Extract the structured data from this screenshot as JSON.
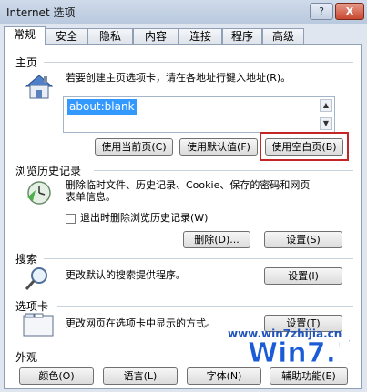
{
  "window": {
    "title": "Internet 选项",
    "help_label": "?",
    "close_label": "X"
  },
  "tabs": [
    {
      "label": "常规"
    },
    {
      "label": "安全"
    },
    {
      "label": "隐私"
    },
    {
      "label": "内容"
    },
    {
      "label": "连接"
    },
    {
      "label": "程序"
    },
    {
      "label": "高级"
    }
  ],
  "home": {
    "title": "主页",
    "desc": "若要创建主页选项卡，请在各地址行键入地址(R)。",
    "address": "about:blank",
    "btn_current": "使用当前页(C)",
    "btn_default": "使用默认值(F)",
    "btn_blank": "使用空白页(B)"
  },
  "history": {
    "title": "浏览历史记录",
    "desc_line1": "删除临时文件、历史记录、Cookie、保存的密码和网页",
    "desc_line2": "表单信息。",
    "checkbox_label": "退出时删除浏览历史记录(W)",
    "btn_delete": "删除(D)...",
    "btn_settings": "设置(S)"
  },
  "search": {
    "title": "搜索",
    "desc": "更改默认的搜索提供程序。",
    "btn_settings": "设置(I)"
  },
  "tabs_section": {
    "title": "选项卡",
    "desc": "更改网页在选项卡中显示的方式。",
    "btn_settings": "设置(T)"
  },
  "appearance": {
    "title": "外观",
    "btn_colors": "颜色(O)",
    "btn_languages": "语言(L)",
    "btn_fonts": "字体(N)",
    "btn_accessibility": "辅助功能(E)"
  },
  "watermark": {
    "url": "www.win7zhijia.cn",
    "logo": "Win7.家"
  },
  "colors": {
    "highlight": "#c42525",
    "selection": "#3399ff"
  }
}
